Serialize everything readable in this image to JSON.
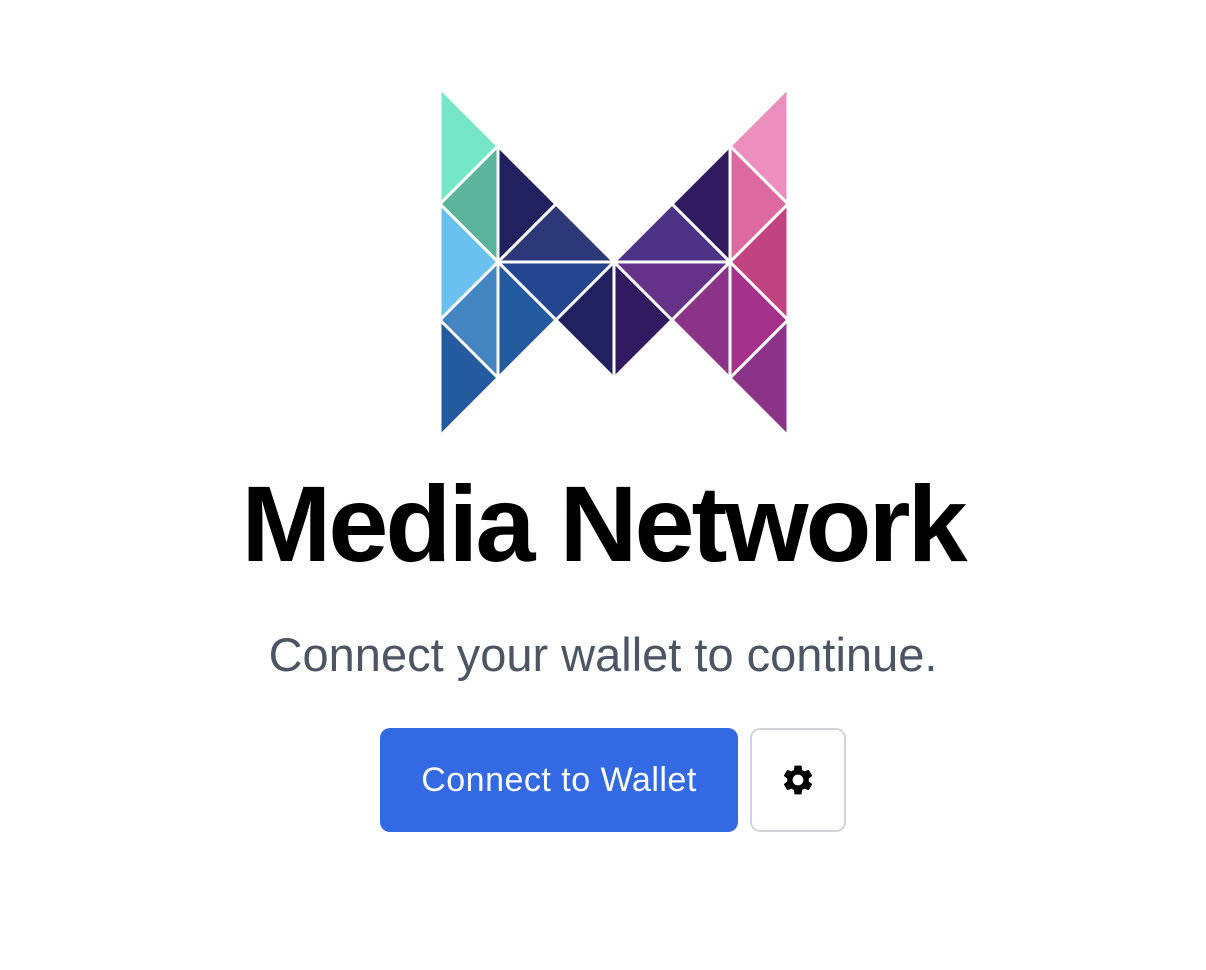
{
  "app": {
    "title": "Media Network",
    "subtitle": "Connect your wallet to continue."
  },
  "actions": {
    "connect_label": "Connect to Wallet",
    "settings_icon": "gear-icon"
  },
  "colors": {
    "primary": "#3469e4",
    "subtitle_text": "#4b5563",
    "button_border": "#d1d5db",
    "logo_palette": [
      "#76e6c8",
      "#5ab49b",
      "#6ac0ee",
      "#4385c0",
      "#245a9e",
      "#222160",
      "#2d3878",
      "#24468e",
      "#321a60",
      "#4d3286",
      "#663189",
      "#8a3388",
      "#a4318a",
      "#c24382",
      "#dc6aa0",
      "#ec8ebd"
    ]
  }
}
